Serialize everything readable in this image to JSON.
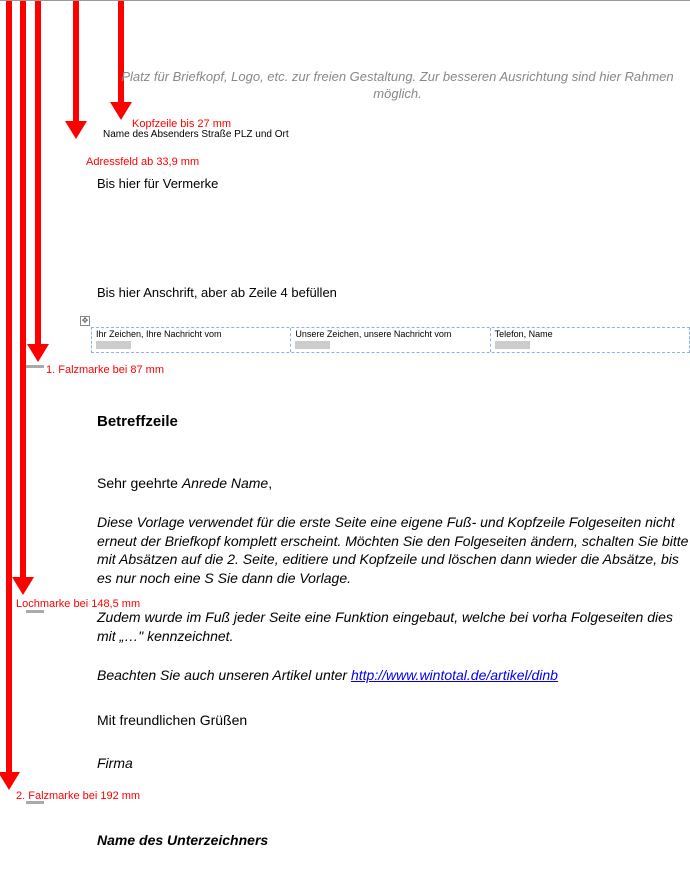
{
  "header_placeholder": "Platz für Briefkopf, Logo, etc. zur freien Gestaltung. Zur besseren Ausrichtung sind hier Rahmen möglich.",
  "annotations": {
    "kopfzeile": "Kopfzeile bis 27 mm",
    "adressfeld": "Adressfeld ab 33,9 mm",
    "falz1": "1. Falzmarke bei 87 mm",
    "lochmarke": "Lochmarke bei  148,5 mm",
    "falz2": "2. Falzmarke bei 192 mm"
  },
  "sender_line": "Name des Absenders   Straße   PLZ und Ort",
  "vermerke": "Bis hier für Vermerke",
  "anschrift": "Bis hier Anschrift, aber ab Zeile 4 befüllen",
  "reference": {
    "col1": "Ihr Zeichen, Ihre Nachricht vom",
    "col2": "Unsere Zeichen, unsere Nachricht vom",
    "col3": "Telefon, Name"
  },
  "betreff": "Betreffzeile",
  "anrede_prefix": "Sehr geehrte ",
  "anrede_var": "Anrede Name",
  "anrede_suffix": ",",
  "para1": "Diese Vorlage verwendet für die erste Seite eine eigene Fuß- und Kopfzeile Folgeseiten nicht erneut der Briefkopf komplett erscheint. Möchten Sie den Folgeseiten ändern, schalten Sie bitte mit Absätzen auf die 2. Seite, editiere und Kopfzeile und löschen dann wieder die Absätze, bis es nur noch eine S Sie dann die Vorlage.",
  "para2_a": "Zudem wurde im Fuß jeder Seite eine Funktion eingebaut, welche bei vorha Folgeseiten dies mit „…\" kennzeichnet.",
  "para3_a": "Beachten Sie auch unseren Artikel unter ",
  "para3_link": "http://www.wintotal.de/artikel/dinb",
  "gruss": "Mit freundlichen Grüßen",
  "firma": "Firma",
  "signer": "Name des Unterzeichners"
}
